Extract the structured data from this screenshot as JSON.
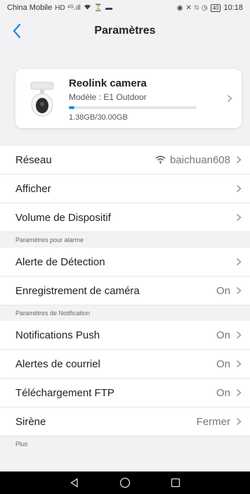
{
  "status_bar": {
    "carrier": "China Mobile",
    "signal": "HD ⁴ᴳ.ıll",
    "battery": "40",
    "time": "10:18"
  },
  "header": {
    "title": "Paramètres"
  },
  "device": {
    "name": "Reolink camera",
    "model": "Modèle : E1 Outdoor",
    "storage_text": "1.38GB/30.00GB",
    "storage_used_fraction": 0.046
  },
  "settings": {
    "network": {
      "label": "Réseau",
      "value": "baichuan608"
    },
    "display": {
      "label": "Afficher"
    },
    "volume": {
      "label": "Volume de Dispositif"
    },
    "alarm_section": "Paramètres pour alarme",
    "detection": {
      "label": "Alerte de Détection"
    },
    "recording": {
      "label": "Enregistrement de caméra",
      "value": "On"
    },
    "notification_section": "Paramètres de Notification",
    "push": {
      "label": "Notifications Push",
      "value": "On"
    },
    "email": {
      "label": "Alertes de courriel",
      "value": "On"
    },
    "ftp": {
      "label": "Téléchargement FTP",
      "value": "On"
    },
    "siren": {
      "label": "Sirène",
      "value": "Fermer"
    },
    "more_section": "Plus"
  },
  "colors": {
    "accent": "#1a8fe0",
    "background": "#f2f2f4"
  }
}
